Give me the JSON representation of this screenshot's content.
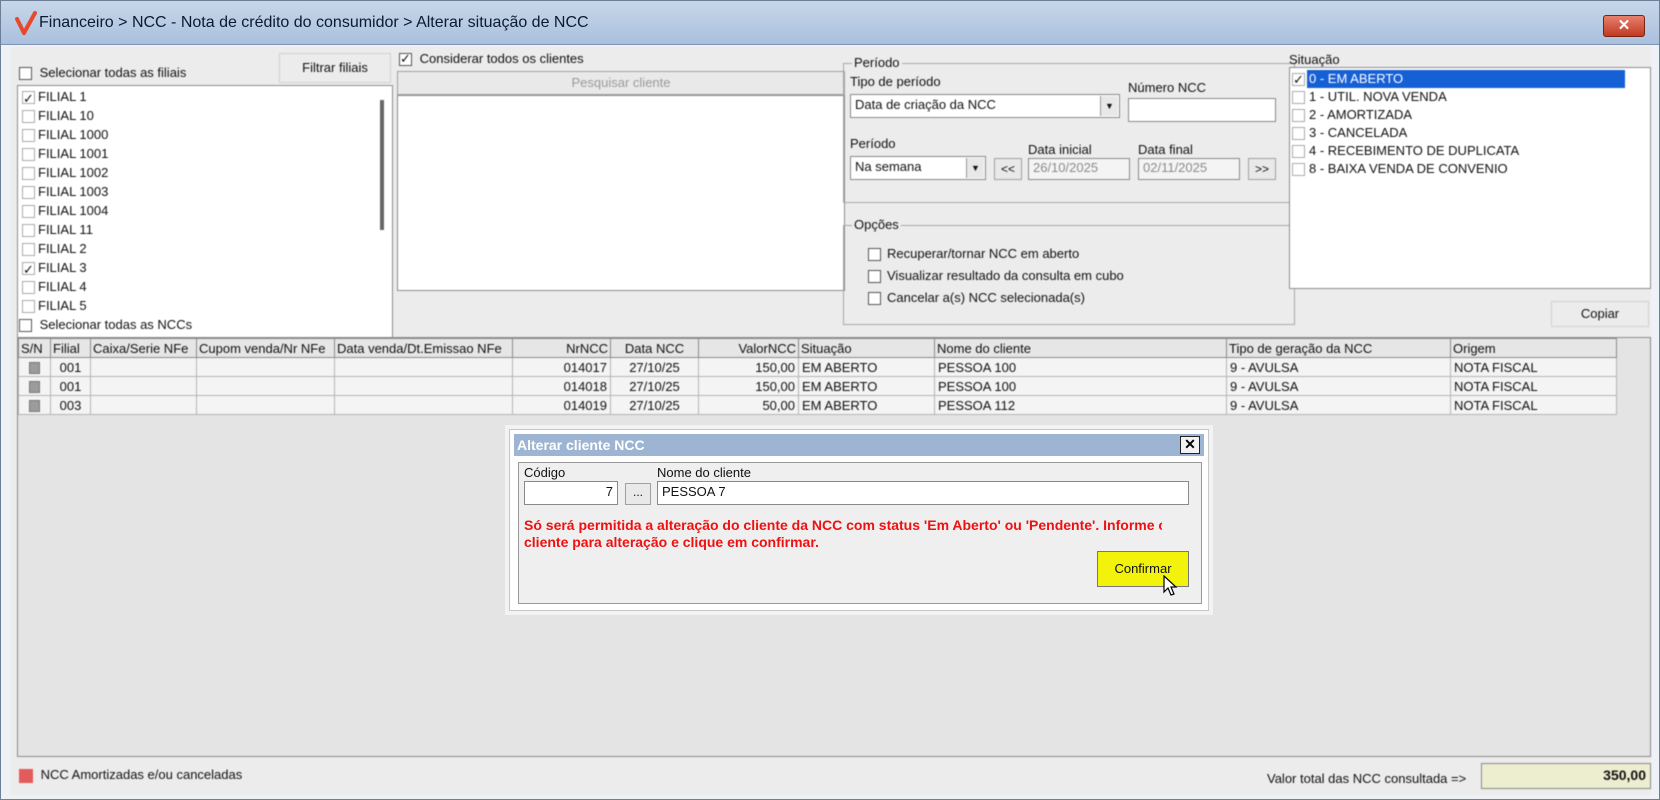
{
  "window": {
    "title": "Financeiro > NCC - Nota de crédito do consumidor > Alterar situação de NCC",
    "close_label": "✕",
    "accent_color": "#a9c0dd"
  },
  "filiais": {
    "select_all_label": "Selecionar todas as filiais",
    "filter_button": "Filtrar filiais",
    "items": [
      {
        "label": "FILIAL 1",
        "checked": true
      },
      {
        "label": "FILIAL 10",
        "checked": false
      },
      {
        "label": "FILIAL 1000",
        "checked": false
      },
      {
        "label": "FILIAL 1001",
        "checked": false
      },
      {
        "label": "FILIAL 1002",
        "checked": false
      },
      {
        "label": "FILIAL 1003",
        "checked": false
      },
      {
        "label": "FILIAL 1004",
        "checked": false
      },
      {
        "label": "FILIAL 11",
        "checked": false
      },
      {
        "label": "FILIAL 2",
        "checked": false
      },
      {
        "label": "FILIAL 3",
        "checked": true
      },
      {
        "label": "FILIAL 4",
        "checked": false
      },
      {
        "label": "FILIAL 5",
        "checked": false
      }
    ]
  },
  "clientes": {
    "consider_all_label": "Considerar todos os clientes",
    "search_button": "Pesquisar cliente"
  },
  "periodo": {
    "group_label": "Período",
    "tipo_label": "Tipo de período",
    "tipo_value": "Data de criação da NCC",
    "numero_label": "Número NCC",
    "numero_value": "",
    "periodo_label": "Período",
    "periodo_value": "Na semana",
    "prev_button": "<<",
    "next_button": ">>",
    "data_inicial_label": "Data inicial",
    "data_inicial_value": "26/10/2025",
    "data_final_label": "Data final",
    "data_final_value": "02/11/2025"
  },
  "opcoes": {
    "group_label": "Opções",
    "items": [
      "Recuperar/tornar NCC em aberto",
      "Visualizar resultado da consulta em cubo",
      "Cancelar a(s) NCC selecionada(s)"
    ]
  },
  "situacao": {
    "label": "Situação",
    "items": [
      {
        "label": "0 - EM ABERTO",
        "checked": true,
        "selected": true
      },
      {
        "label": "1 - UTIL. NOVA VENDA",
        "checked": false,
        "selected": false
      },
      {
        "label": "2 - AMORTIZADA",
        "checked": false,
        "selected": false
      },
      {
        "label": "3 - CANCELADA",
        "checked": false,
        "selected": false
      },
      {
        "label": "4 - RECEBIMENTO DE DUPLICATA",
        "checked": false,
        "selected": false
      },
      {
        "label": "8 - BAIXA VENDA DE CONVENIO",
        "checked": false,
        "selected": false
      }
    ],
    "copy_button": "Copiar"
  },
  "grid": {
    "select_all_label": "Selecionar todas as NCCs",
    "columns": [
      "S/N",
      "Filial",
      "Caixa/Serie NFe",
      "Cupom venda/Nr NFe",
      "Data venda/Dt.Emissao NFe",
      "NrNCC",
      "Data NCC",
      "ValorNCC",
      "Situação",
      "Nome do cliente",
      "Tipo de geração da NCC",
      "Origem"
    ],
    "rows": [
      [
        "",
        "001",
        "",
        "",
        "",
        "014017",
        "27/10/25",
        "150,00",
        "EM ABERTO",
        "PESSOA 100",
        "9 - AVULSA",
        "NOTA FISCAL"
      ],
      [
        "",
        "001",
        "",
        "",
        "",
        "014018",
        "27/10/25",
        "150,00",
        "EM ABERTO",
        "PESSOA 100",
        "9 - AVULSA",
        "NOTA FISCAL"
      ],
      [
        "",
        "003",
        "",
        "",
        "",
        "014019",
        "27/10/25",
        "50,00",
        "EM ABERTO",
        "PESSOA 112",
        "9 - AVULSA",
        "NOTA FISCAL"
      ]
    ]
  },
  "footer": {
    "legend_label": "NCC Amortizadas e/ou canceladas",
    "legend_color": "#e35b5b",
    "total_label": "Valor total das NCC consultada =>",
    "total_value": "350,00"
  },
  "dialog": {
    "title": "Alterar cliente NCC",
    "close_label": "✕",
    "codigo_label": "Código",
    "codigo_value": "7",
    "nome_label": "Nome do cliente",
    "nome_value": "PESSOA 7",
    "lookup_label": "...",
    "warning_line1": "Só será permitida a alteração do cliente da NCC com status 'Em Aberto' ou 'Pendente'. Informe o",
    "warning_line2": "cliente para alteração e clique em confirmar.",
    "confirm_button": "Confirmar",
    "confirm_color": "#f2f20a"
  }
}
